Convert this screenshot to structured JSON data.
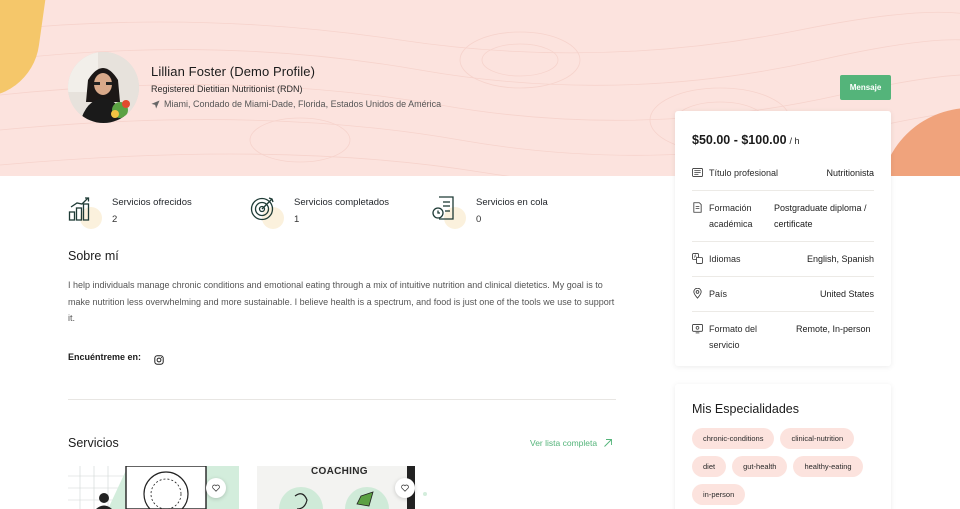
{
  "profile": {
    "name": "Lillian Foster (Demo Profile)",
    "title": "Registered Dietitian Nutritionist (RDN)",
    "location": "Miami, Condado de Miami-Dade, Florida, Estados Unidos de América",
    "message_button": "Mensaje"
  },
  "pricing": {
    "price": "$50.00 - $100.00",
    "unit": "/ h"
  },
  "details": [
    {
      "label": "Título profesional",
      "value": "Nutritionista",
      "icon": "id-card-icon"
    },
    {
      "label": "Formación académica",
      "value": "Postgraduate diploma / certificate",
      "icon": "document-icon"
    },
    {
      "label": "Idiomas",
      "value": "English, Spanish",
      "icon": "translate-icon"
    },
    {
      "label": "País",
      "value": "United States",
      "icon": "location-pin-icon"
    },
    {
      "label": "Formato del servicio",
      "value": "Remote, In-person",
      "icon": "screen-icon"
    }
  ],
  "stats": [
    {
      "label": "Servicios ofrecidos",
      "value": "2",
      "icon": "chart-steps-icon"
    },
    {
      "label": "Servicios completados",
      "value": "1",
      "icon": "target-icon"
    },
    {
      "label": "Servicios en cola",
      "value": "0",
      "icon": "queue-document-icon"
    }
  ],
  "about": {
    "heading": "Sobre mí",
    "text": "I help individuals manage chronic conditions and emotional eating through a mix of intuitive nutrition and clinical dietetics. My goal is to make nutrition less overwhelming and more sustainable. I believe health is a spectrum, and food is just one of the tools we use to support it."
  },
  "social": {
    "label": "Encuéntreme en:",
    "icon": "instagram-icon"
  },
  "services": {
    "heading": "Servicios",
    "see_all": "Ver lista completa",
    "card2_text": "COACHING"
  },
  "specialties": {
    "heading": "Mis Especialidades",
    "tags": [
      "chronic-conditions",
      "clinical-nutrition",
      "diet",
      "gut-health",
      "healthy-eating",
      "in-person"
    ]
  },
  "colors": {
    "hero_bg": "#fce3de",
    "accent_green": "#54b47a",
    "tag_bg": "#fce3de",
    "blob_yellow": "#f5c76a",
    "blob_orange": "#f0a37c"
  }
}
